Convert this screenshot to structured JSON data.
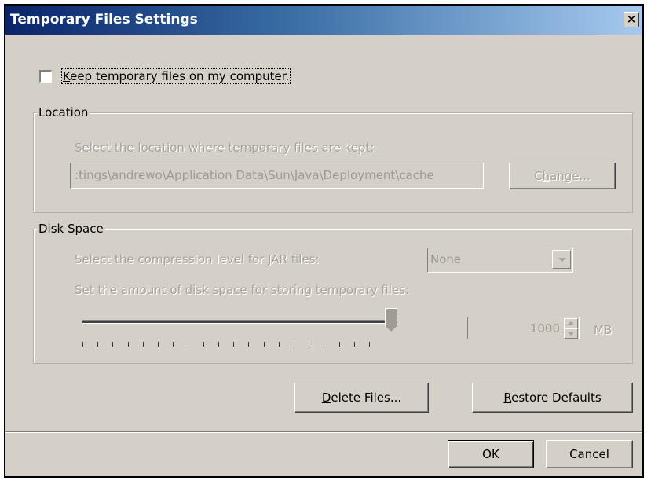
{
  "window": {
    "title": "Temporary Files Settings",
    "close_glyph": "×"
  },
  "keep_files": {
    "label": "Keep temporary files on my computer.",
    "checked": false
  },
  "location": {
    "group_title": "Location",
    "prompt": "Select the location where temporary files are kept:",
    "path_value": ":tings\\andrewo\\Application Data\\Sun\\Java\\Deployment\\cache",
    "change_button": "Change..."
  },
  "disk_space": {
    "group_title": "Disk Space",
    "compression_prompt": "Select the compression level for JAR files:",
    "compression_value": "None",
    "space_prompt": "Set the amount of disk space for storing temporary files:",
    "slider_level_fraction": 1.0,
    "amount_value": "1000",
    "unit_label": "MB"
  },
  "actions": {
    "delete_button": "Delete Files...",
    "restore_button": "Restore Defaults",
    "ok_button": "OK",
    "cancel_button": "Cancel"
  },
  "colors": {
    "title_bar_start": "#0a246a",
    "title_bar_end": "#a6caf0",
    "dialog_background": "#d4d0c8",
    "disabled_text": "#a8a49c"
  }
}
